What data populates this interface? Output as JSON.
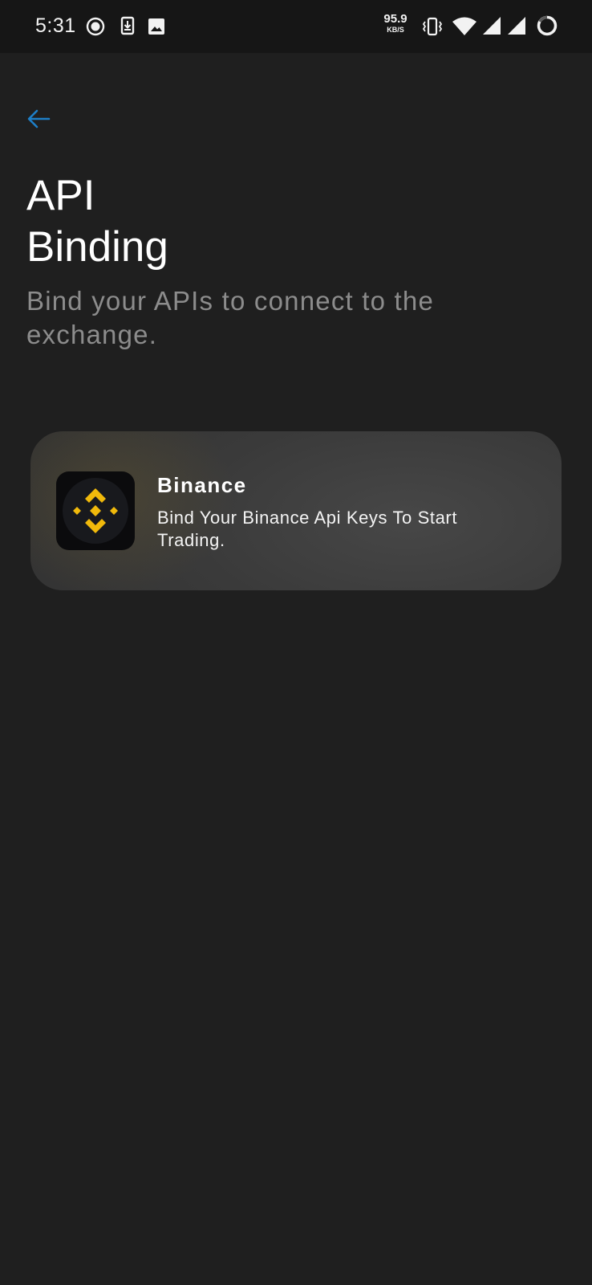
{
  "status_bar": {
    "time": "5:31",
    "net_speed_value": "95.9",
    "net_speed_unit": "KB/S",
    "icons": [
      "record-icon",
      "download-icon",
      "image-icon",
      "vibrate-icon",
      "wifi-icon",
      "signal-icon",
      "signal-icon",
      "battery-ring-icon"
    ]
  },
  "nav": {
    "back_icon": "arrow-left-icon",
    "back_color": "#1e7fc7"
  },
  "header": {
    "title_line1": "API",
    "title_line2": "Binding",
    "subtitle": "Bind your APIs to connect to the exchange."
  },
  "exchanges": [
    {
      "name": "Binance",
      "description": "Bind Your Binance Api Keys To Start Trading.",
      "logo": "binance-logo-icon",
      "logo_color": "#f0b90b"
    }
  ]
}
